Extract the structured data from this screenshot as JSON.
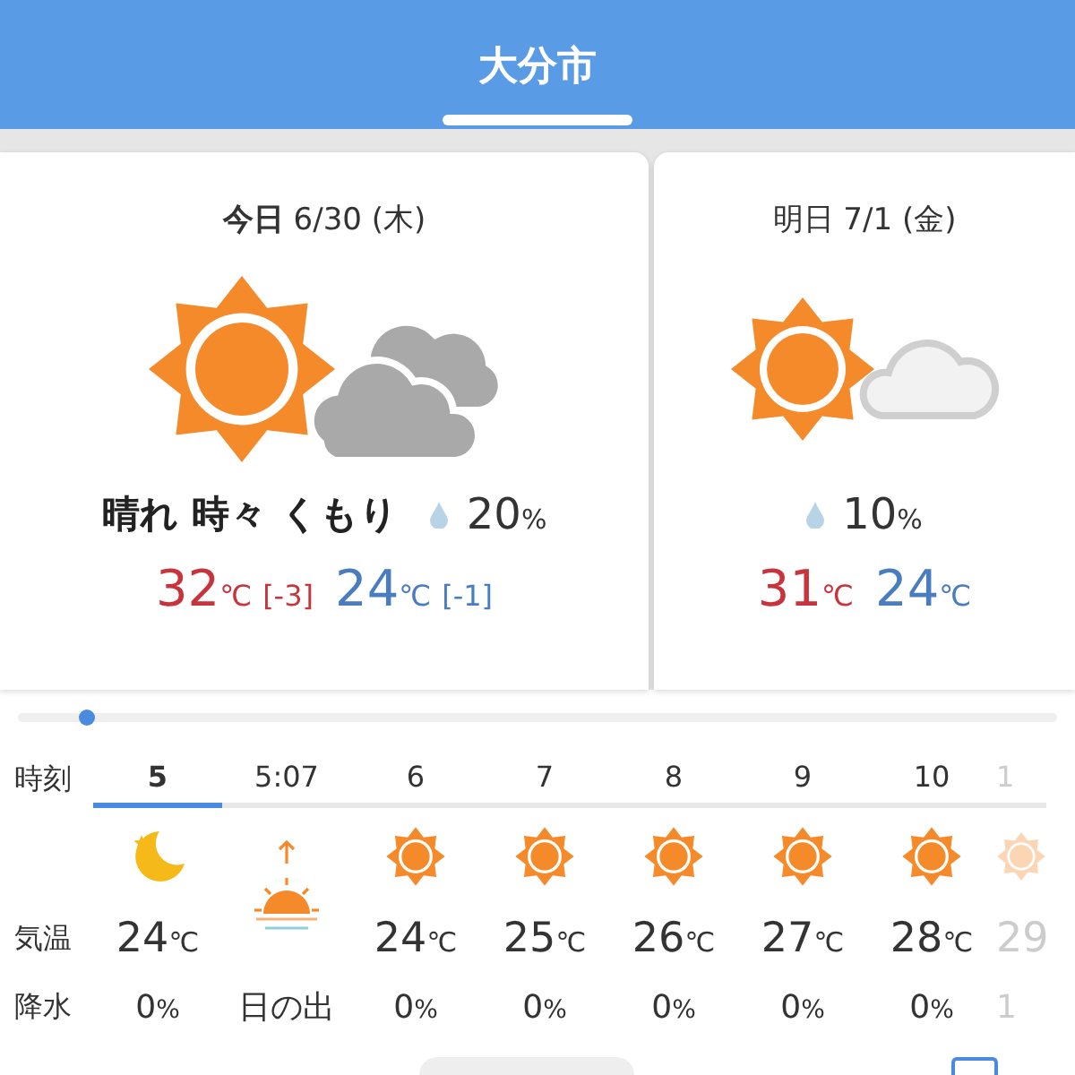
{
  "header": {
    "title": "大分市"
  },
  "days": [
    {
      "kind": "today",
      "label": "今日",
      "date": "6/30 (木)",
      "weather": "晴れ 時々 くもり",
      "rain": "20",
      "rain_unit": "%",
      "high": "32",
      "high_unit": "℃",
      "high_diff": "[-3]",
      "low": "24",
      "low_unit": "℃",
      "low_diff": "[-1]"
    },
    {
      "kind": "tomorrow",
      "label": "明日",
      "date": "7/1 (金)",
      "rain": "10",
      "rain_unit": "%",
      "high": "31",
      "high_unit": "℃",
      "low": "24",
      "low_unit": "℃"
    }
  ],
  "hourly": {
    "row_labels": [
      "時刻",
      "気温",
      "降水"
    ],
    "columns": [
      {
        "hour": "5",
        "selected": true,
        "kind": "moon",
        "temp": "24",
        "temp_unit": "℃",
        "precip": "0",
        "precip_unit": "%",
        "faded": false
      },
      {
        "hour": "5:07",
        "selected": false,
        "kind": "sunrise",
        "precip": "日の出",
        "faded": false
      },
      {
        "hour": "6",
        "selected": false,
        "kind": "sun",
        "temp": "24",
        "temp_unit": "℃",
        "precip": "0",
        "precip_unit": "%",
        "faded": false
      },
      {
        "hour": "7",
        "selected": false,
        "kind": "sun",
        "temp": "25",
        "temp_unit": "℃",
        "precip": "0",
        "precip_unit": "%",
        "faded": false
      },
      {
        "hour": "8",
        "selected": false,
        "kind": "sun",
        "temp": "26",
        "temp_unit": "℃",
        "precip": "0",
        "precip_unit": "%",
        "faded": false
      },
      {
        "hour": "9",
        "selected": false,
        "kind": "sun",
        "temp": "27",
        "temp_unit": "℃",
        "precip": "0",
        "precip_unit": "%",
        "faded": false
      },
      {
        "hour": "10",
        "selected": false,
        "kind": "sun",
        "temp": "28",
        "temp_unit": "℃",
        "precip": "0",
        "precip_unit": "%",
        "faded": false
      },
      {
        "hour": "1",
        "selected": false,
        "kind": "sun",
        "temp": "29",
        "precip": "1",
        "faded": true
      }
    ]
  }
}
